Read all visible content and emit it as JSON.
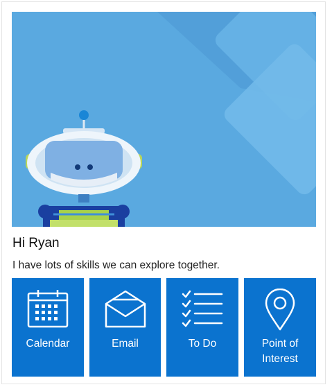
{
  "greeting": "Hi Ryan",
  "subtitle": "I have lots of skills we can explore together.",
  "colors": {
    "tile_bg": "#0b73cf",
    "hero_bg": "#5aa9e0"
  },
  "tiles": [
    {
      "label": "Calendar",
      "icon": "calendar-icon"
    },
    {
      "label": "Email",
      "icon": "envelope-icon"
    },
    {
      "label": "To Do",
      "icon": "checklist-icon"
    },
    {
      "label": "Point of Interest",
      "icon": "map-pin-icon"
    }
  ]
}
